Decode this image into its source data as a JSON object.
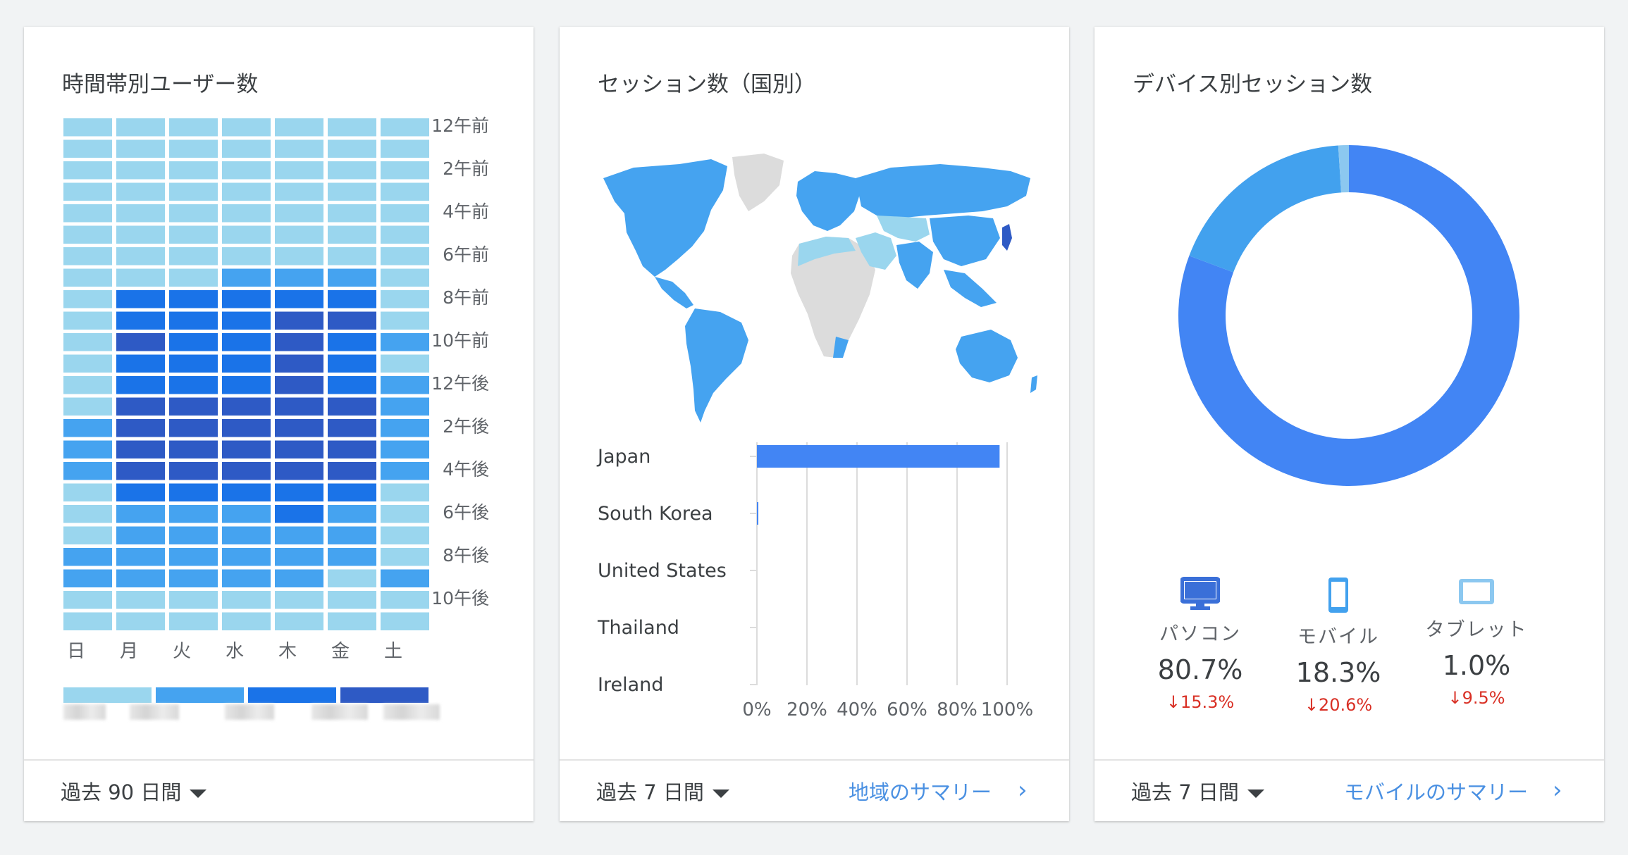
{
  "heatmap_card": {
    "title": "時間帯別ユーザー数",
    "range_label": "過去 90 日間",
    "legend_colors": [
      "#9ad6ee",
      "#45a3f0",
      "#1a73e8",
      "#2e5ac5"
    ]
  },
  "country_card": {
    "title": "セッション数（国別）",
    "range_label": "過去 7 日間",
    "link_label": "地域のサマリー",
    "chevron": "›"
  },
  "device_card": {
    "title": "デバイス別セッション数",
    "range_label": "過去 7 日間",
    "link_label": "モバイルのサマリー",
    "chevron": "›",
    "devices": [
      {
        "icon": "desktop-icon",
        "label": "パソコン",
        "value": "80.7%",
        "change": "15.3%"
      },
      {
        "icon": "mobile-icon",
        "label": "モバイル",
        "value": "18.3%",
        "change": "20.6%"
      },
      {
        "icon": "tablet-icon",
        "label": "タブレット",
        "value": "1.0%",
        "change": "9.5%"
      }
    ],
    "change_arrow": "↓"
  },
  "colors": {
    "level1": "#9ad6ee",
    "level2": "#45a3f0",
    "level3": "#1a73e8",
    "level4": "#2e5ac5",
    "desktop": "#4285f4",
    "mobile": "#42a1ee",
    "tablet": "#8cc8f0",
    "bar": "#4285f4",
    "decline": "#d93025",
    "link": "#4a90e2"
  },
  "chart_data": [
    {
      "type": "heatmap",
      "title": "時間帯別ユーザー数",
      "x": [
        "日",
        "月",
        "火",
        "水",
        "木",
        "金",
        "土"
      ],
      "y_tick_labels": [
        "12午前",
        "2午前",
        "4午前",
        "6午前",
        "8午前",
        "10午前",
        "12午後",
        "2午後",
        "4午後",
        "6午後",
        "8午後",
        "10午後"
      ],
      "hours": 24,
      "levels": [
        [
          1,
          1,
          1,
          1,
          1,
          1,
          1
        ],
        [
          1,
          1,
          1,
          1,
          1,
          1,
          1
        ],
        [
          1,
          1,
          1,
          1,
          1,
          1,
          1
        ],
        [
          1,
          1,
          1,
          1,
          1,
          1,
          1
        ],
        [
          1,
          1,
          1,
          1,
          1,
          1,
          1
        ],
        [
          1,
          1,
          1,
          1,
          1,
          1,
          1
        ],
        [
          1,
          1,
          1,
          1,
          1,
          1,
          1
        ],
        [
          1,
          1,
          1,
          2,
          2,
          2,
          1
        ],
        [
          1,
          3,
          3,
          3,
          3,
          3,
          1
        ],
        [
          1,
          3,
          3,
          3,
          4,
          4,
          1
        ],
        [
          1,
          4,
          3,
          3,
          4,
          3,
          2
        ],
        [
          1,
          3,
          3,
          3,
          4,
          3,
          1
        ],
        [
          1,
          3,
          3,
          3,
          4,
          3,
          2
        ],
        [
          1,
          4,
          4,
          4,
          4,
          4,
          2
        ],
        [
          2,
          4,
          4,
          4,
          4,
          4,
          2
        ],
        [
          2,
          4,
          4,
          4,
          4,
          4,
          2
        ],
        [
          2,
          4,
          4,
          4,
          4,
          4,
          2
        ],
        [
          1,
          3,
          3,
          3,
          3,
          3,
          1
        ],
        [
          1,
          2,
          2,
          2,
          3,
          2,
          1
        ],
        [
          1,
          2,
          2,
          2,
          2,
          2,
          1
        ],
        [
          2,
          2,
          2,
          2,
          2,
          2,
          1
        ],
        [
          2,
          2,
          2,
          2,
          2,
          1,
          2
        ],
        [
          1,
          1,
          1,
          1,
          1,
          1,
          1
        ],
        [
          1,
          1,
          1,
          1,
          1,
          1,
          1
        ]
      ]
    },
    {
      "type": "bar",
      "title": "セッション数（国別）",
      "orientation": "horizontal",
      "categories": [
        "Japan",
        "South Korea",
        "United States",
        "Thailand",
        "Ireland"
      ],
      "values": [
        97,
        0.5,
        0,
        0,
        0
      ],
      "x_tick_labels": [
        "0%",
        "20%",
        "40%",
        "60%",
        "80%",
        "100%"
      ],
      "xlim": [
        0,
        100
      ],
      "grid": true
    },
    {
      "type": "pie",
      "title": "デバイス別セッション数",
      "donut": true,
      "categories": [
        "パソコン",
        "モバイル",
        "タブレット"
      ],
      "values": [
        80.7,
        18.3,
        1.0
      ]
    }
  ]
}
